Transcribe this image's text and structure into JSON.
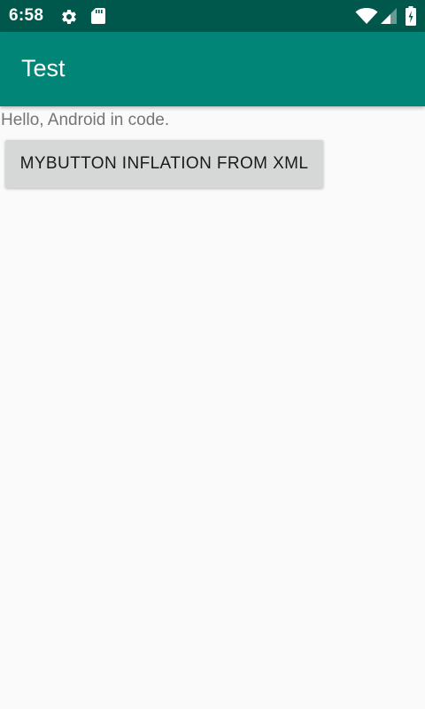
{
  "status_bar": {
    "time": "6:58",
    "icons": [
      "gear-icon",
      "sd-card-icon",
      "wifi-icon",
      "cell-signal-icon",
      "battery-icon"
    ],
    "background_color": "#00574b"
  },
  "app_bar": {
    "title": "Test",
    "background_color": "#008577"
  },
  "main": {
    "hello_text": "Hello, Android in code.",
    "button_label": "MYBUTTON INFLATION FROM XML"
  }
}
